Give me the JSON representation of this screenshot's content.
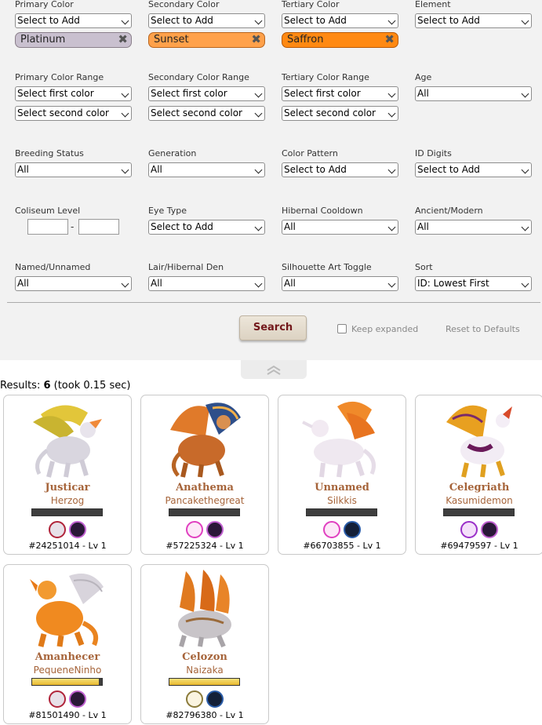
{
  "filters": {
    "primary_color": {
      "label": "Primary Color",
      "select": "Select to Add",
      "chip": "Platinum",
      "chip_color": "#c9c0cf"
    },
    "secondary_color": {
      "label": "Secondary Color",
      "select": "Select to Add",
      "chip": "Sunset",
      "chip_color": "#ffa14a"
    },
    "tertiary_color": {
      "label": "Tertiary Color",
      "select": "Select to Add",
      "chip": "Saffron",
      "chip_color": "#ff8912"
    },
    "element": {
      "label": "Element",
      "select": "Select to Add"
    },
    "primary_range": {
      "label": "Primary Color Range",
      "first": "Select first color",
      "second": "Select second color"
    },
    "secondary_range": {
      "label": "Secondary Color Range",
      "first": "Select first color",
      "second": "Select second color"
    },
    "tertiary_range": {
      "label": "Tertiary Color Range",
      "first": "Select first color",
      "second": "Select second color"
    },
    "age": {
      "label": "Age",
      "select": "All"
    },
    "breeding_status": {
      "label": "Breeding Status",
      "select": "All"
    },
    "generation": {
      "label": "Generation",
      "select": "All"
    },
    "color_pattern": {
      "label": "Color Pattern",
      "select": "Select to Add"
    },
    "id_digits": {
      "label": "ID Digits",
      "select": "Select to Add"
    },
    "coliseum_level": {
      "label": "Coliseum Level",
      "min": "",
      "max": "",
      "separator": "-"
    },
    "eye_type": {
      "label": "Eye Type",
      "select": "Select to Add"
    },
    "hibernal_cooldown": {
      "label": "Hibernal Cooldown",
      "select": "All"
    },
    "ancient_modern": {
      "label": "Ancient/Modern",
      "select": "All"
    },
    "named_unnamed": {
      "label": "Named/Unnamed",
      "select": "All"
    },
    "lair_den": {
      "label": "Lair/Hibernal Den",
      "select": "All"
    },
    "silhouette": {
      "label": "Silhouette Art Toggle",
      "select": "All"
    },
    "sort": {
      "label": "Sort",
      "select": "ID: Lowest First"
    }
  },
  "actions": {
    "search_label": "Search",
    "keep_expanded_label": "Keep expanded",
    "reset_label": "Reset to Defaults"
  },
  "results": {
    "prefix": "Results: ",
    "count": "6",
    "timing": "(took 0.15 sec)"
  },
  "dragons": [
    {
      "name": "Justicar",
      "owner": "Herzog",
      "id": "#24251014 - Lv 1",
      "energy": 0,
      "icons": [
        "tiered-spiral-icon",
        "female-gender-icon"
      ]
    },
    {
      "name": "Anathema",
      "owner": "Pancakethegreat",
      "id": "#57225324 - Lv 1",
      "energy": 0,
      "icons": [
        "pink-spiral-icon",
        "female-gender-icon"
      ]
    },
    {
      "name": "Unnamed",
      "owner": "Silkkis",
      "id": "#66703855 - Lv 1",
      "energy": 0,
      "icons": [
        "pink-spiral-icon",
        "male-gender-icon"
      ]
    },
    {
      "name": "Celegriath",
      "owner": "Kasumidemon",
      "id": "#69479597 - Lv 1",
      "energy": 0,
      "icons": [
        "purple-swirl-icon",
        "female-gender-icon"
      ]
    },
    {
      "name": "Amanhecer",
      "owner": "PequeneNinho",
      "id": "#81501490 - Lv 1",
      "energy": 0.95,
      "icons": [
        "tiered-spiral-icon",
        "female-gender-icon"
      ]
    },
    {
      "name": "Celozon",
      "owner": "Naizaka",
      "id": "#82796380 - Lv 1",
      "energy": 1,
      "icons": [
        "wing-tiers-icon",
        "male-gender-icon"
      ]
    }
  ],
  "colors": {
    "accent": "#a6643a",
    "button_text": "#73181b",
    "panel": "#f2f2f2"
  }
}
